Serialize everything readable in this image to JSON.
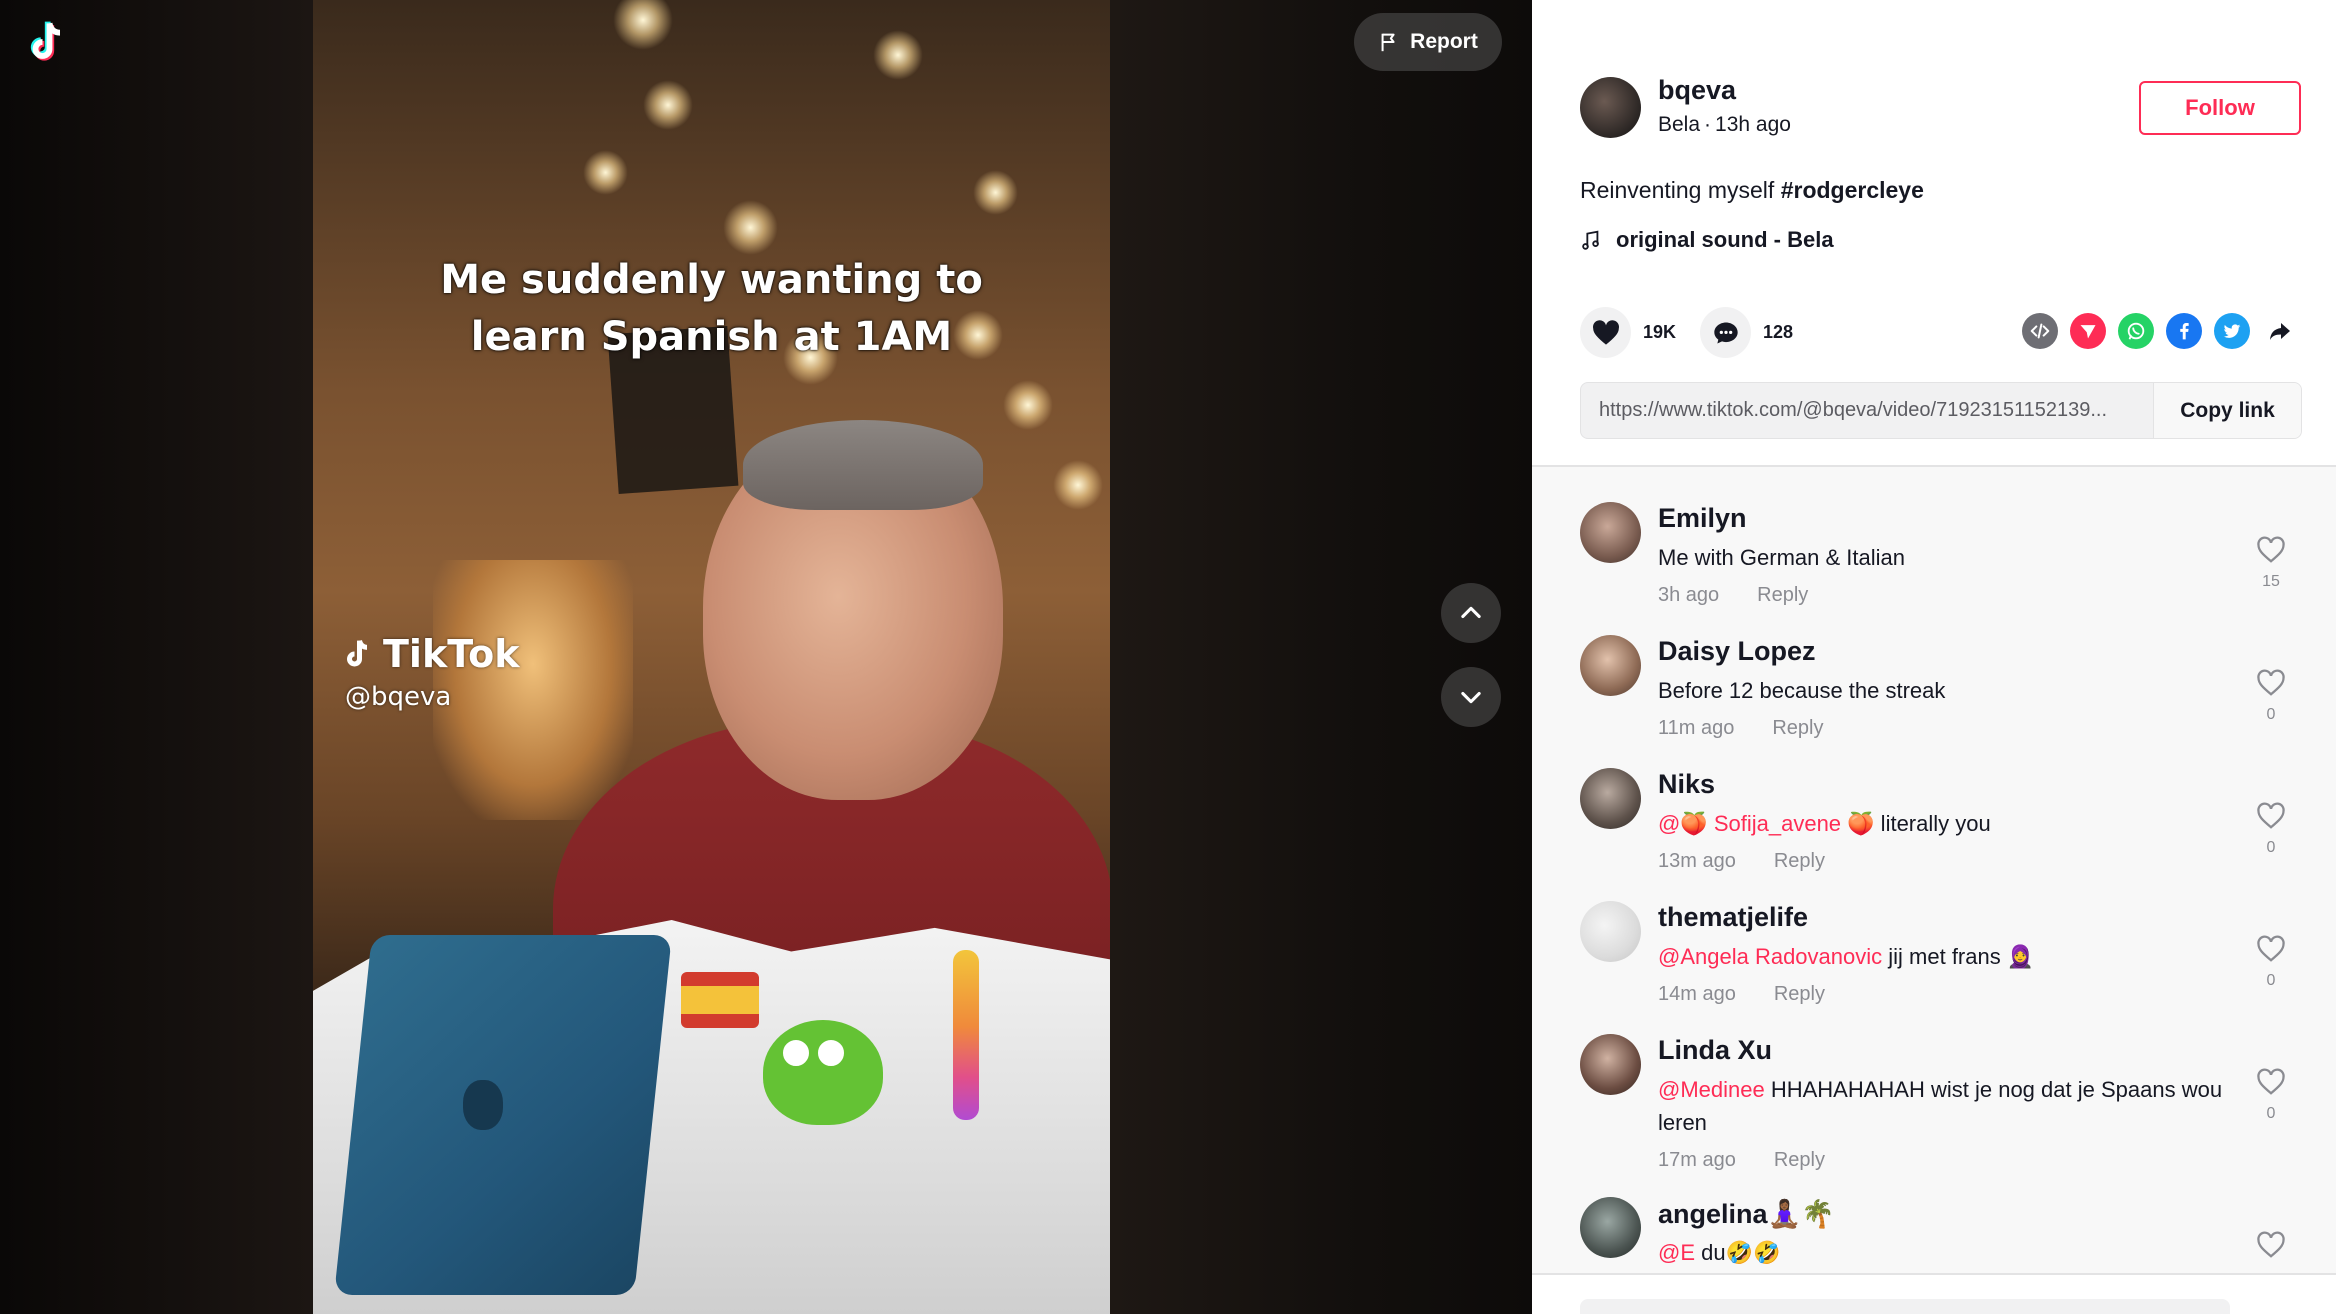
{
  "app": {
    "logo_icon": "tiktok-logo-icon"
  },
  "video": {
    "caption_lines": [
      "Me suddenly wanting to",
      "learn Spanish at 1AM"
    ],
    "watermark_brand": "TikTok",
    "watermark_handle": "@bqeva"
  },
  "controls": {
    "report_label": "Report",
    "nav_up_icon": "chevron-up-icon",
    "nav_down_icon": "chevron-down-icon"
  },
  "author": {
    "username": "bqeva",
    "nickname": "Bela",
    "time": "13h ago",
    "follow_label": "Follow"
  },
  "post": {
    "description": "Reinventing myself",
    "hashtag": "#rodgercleye",
    "music": "original sound - Bela",
    "likes": "19K",
    "comments": "128",
    "link": "https://www.tiktok.com/@bqeva/video/71923151152139...",
    "copy_label": "Copy link"
  },
  "share": [
    {
      "icon": "embed-icon",
      "color": "#6e6e74"
    },
    {
      "icon": "send-icon",
      "color": "#fe2c55"
    },
    {
      "icon": "whatsapp-icon",
      "color": "#25d366"
    },
    {
      "icon": "facebook-icon",
      "color": "#1877f2"
    },
    {
      "icon": "twitter-icon",
      "color": "#1da1f2"
    },
    {
      "icon": "share-arrow-icon",
      "color": "#161823"
    }
  ],
  "colors": {
    "accent": "#fe2c55",
    "text": "#161823",
    "muted": "#8a8b91"
  },
  "comment_list": [
    {
      "name": "Emilyn",
      "mention": "",
      "text": "Me with German & Italian",
      "time": "3h ago",
      "reply": "Reply",
      "likes": "15"
    },
    {
      "name": "Daisy Lopez",
      "mention": "",
      "text": "Before 12 because the streak",
      "time": "11m ago",
      "reply": "Reply",
      "likes": "0"
    },
    {
      "name": "Niks",
      "mention": "@🍑 Sofija_avene 🍑",
      "text": " literally you",
      "time": "13m ago",
      "reply": "Reply",
      "likes": "0"
    },
    {
      "name": "thematjelife",
      "mention": "@Angela Radovanovic",
      "text": " jij met frans 🧕",
      "time": "14m ago",
      "reply": "Reply",
      "likes": "0"
    },
    {
      "name": "Linda Xu",
      "mention": "@Medinee",
      "text": " HHAHAHAHAH wist je nog dat je Spaans wou leren",
      "time": "17m ago",
      "reply": "Reply",
      "likes": "0"
    },
    {
      "name": "angelina🧘🏾‍♀️🌴",
      "mention": "@E",
      "text": " du🤣🤣",
      "time": "",
      "reply": "",
      "likes": ""
    }
  ]
}
